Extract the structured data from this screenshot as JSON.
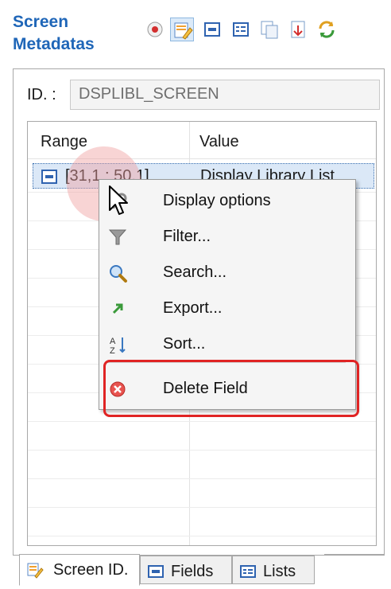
{
  "panel": {
    "title": "Screen Metadatas",
    "toolbar": [
      {
        "name": "record-icon"
      },
      {
        "name": "screen-edit-icon",
        "active": true
      },
      {
        "name": "field-icon"
      },
      {
        "name": "list-icon"
      },
      {
        "name": "screen-copy-icon"
      },
      {
        "name": "export-down-icon"
      },
      {
        "name": "refresh-icon"
      }
    ]
  },
  "id_field": {
    "label": "ID. :",
    "value": "DSPLIBL_SCREEN"
  },
  "table": {
    "columns": [
      "Range",
      "Value"
    ],
    "rows": [
      {
        "range": "[31,1 : 50,1]",
        "value": "Display Library List"
      }
    ]
  },
  "context_menu": {
    "items": [
      {
        "label": "Display options",
        "icon": "wrench-icon"
      },
      {
        "label": "Filter...",
        "icon": "filter-icon"
      },
      {
        "label": "Search...",
        "icon": "magnifier-icon"
      },
      {
        "label": "Export...",
        "icon": "export-arrow-icon"
      },
      {
        "label": "Sort...",
        "icon": "sort-az-icon"
      },
      {
        "label": "Delete Field",
        "icon": "delete-icon"
      }
    ],
    "highlight_color": "#e02424"
  },
  "tabs": [
    {
      "label": "Screen ID.",
      "icon": "screen-id-icon",
      "active": true
    },
    {
      "label": "Fields",
      "icon": "field-icon",
      "active": false
    },
    {
      "label": "Lists",
      "icon": "list-icon",
      "active": false
    }
  ],
  "colors": {
    "accent": "#1f66b8",
    "selection": "#dbe8f7",
    "highlight": "#e02424"
  }
}
